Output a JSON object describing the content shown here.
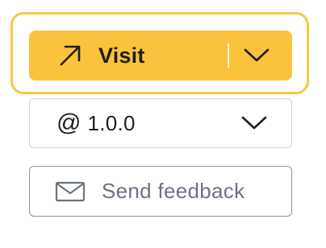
{
  "visit_button": {
    "label": "Visit",
    "icon": "arrow-up-right-icon",
    "dropdown_icon": "chevron-down-icon",
    "accent_color": "#fbc23b",
    "focus_ring_color": "#f6c944",
    "focused": true
  },
  "version_select": {
    "prefix": "@",
    "value": "1.0.0",
    "dropdown_icon": "chevron-down-icon"
  },
  "feedback_button": {
    "label": "Send feedback",
    "icon": "envelope-icon"
  }
}
